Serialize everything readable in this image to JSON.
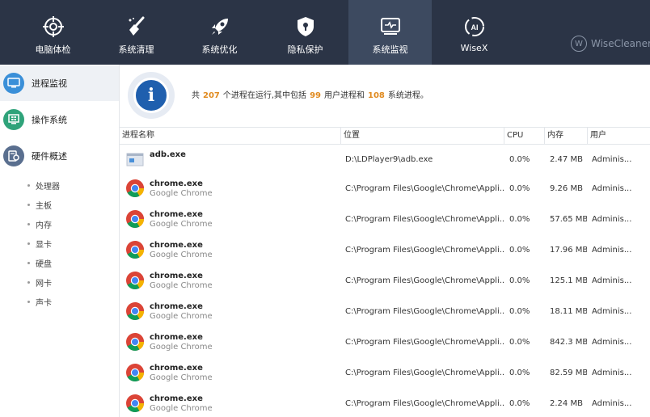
{
  "nav": [
    {
      "label": "电脑体检",
      "icon": "crosshair-icon"
    },
    {
      "label": "系统清理",
      "icon": "broom-icon"
    },
    {
      "label": "系统优化",
      "icon": "rocket-icon"
    },
    {
      "label": "隐私保护",
      "icon": "shield-lock-icon"
    },
    {
      "label": "系统监视",
      "icon": "monitor-pulse-icon"
    },
    {
      "label": "WiseX",
      "icon": "wisex-logo-icon"
    }
  ],
  "brand": {
    "name": "WiseCleaner"
  },
  "sidebar": {
    "items": [
      {
        "label": "进程监视",
        "icon": "monitor-icon",
        "color": "#3a8fd8"
      },
      {
        "label": "操作系统",
        "icon": "windows-icon",
        "color": "#2fa37a"
      },
      {
        "label": "硬件概述",
        "icon": "hardware-icon",
        "color": "#5a6f8f"
      }
    ],
    "subitems": [
      "处理器",
      "主板",
      "内存",
      "显卡",
      "硬盘",
      "网卡",
      "声卡"
    ]
  },
  "summary": {
    "prefix": "共",
    "total": "207",
    "mid1": "个进程在运行,其中包括",
    "user": "99",
    "mid2": "用户进程和",
    "system": "108",
    "suffix": "系统进程。"
  },
  "table": {
    "columns": [
      "进程名称",
      "位置",
      "CPU",
      "内存",
      "用户"
    ],
    "rows": [
      {
        "name": "adb.exe",
        "desc": "",
        "path": "D:\\LDPlayer9\\adb.exe",
        "cpu": "0.0%",
        "mem": "2.47 MB",
        "user": "Adminis...",
        "icon": "exe-icon"
      },
      {
        "name": "chrome.exe",
        "desc": "Google Chrome",
        "path": "C:\\Program Files\\Google\\Chrome\\Appli...",
        "cpu": "0.0%",
        "mem": "9.26 MB",
        "user": "Adminis...",
        "icon": "chrome-icon"
      },
      {
        "name": "chrome.exe",
        "desc": "Google Chrome",
        "path": "C:\\Program Files\\Google\\Chrome\\Appli...",
        "cpu": "0.0%",
        "mem": "57.65 MB",
        "user": "Adminis...",
        "icon": "chrome-icon"
      },
      {
        "name": "chrome.exe",
        "desc": "Google Chrome",
        "path": "C:\\Program Files\\Google\\Chrome\\Appli...",
        "cpu": "0.0%",
        "mem": "17.96 MB",
        "user": "Adminis...",
        "icon": "chrome-icon"
      },
      {
        "name": "chrome.exe",
        "desc": "Google Chrome",
        "path": "C:\\Program Files\\Google\\Chrome\\Appli...",
        "cpu": "0.0%",
        "mem": "125.1 MB",
        "user": "Adminis...",
        "icon": "chrome-icon"
      },
      {
        "name": "chrome.exe",
        "desc": "Google Chrome",
        "path": "C:\\Program Files\\Google\\Chrome\\Appli...",
        "cpu": "0.0%",
        "mem": "18.11 MB",
        "user": "Adminis...",
        "icon": "chrome-icon"
      },
      {
        "name": "chrome.exe",
        "desc": "Google Chrome",
        "path": "C:\\Program Files\\Google\\Chrome\\Appli...",
        "cpu": "0.0%",
        "mem": "842.3 MB",
        "user": "Adminis...",
        "icon": "chrome-icon"
      },
      {
        "name": "chrome.exe",
        "desc": "Google Chrome",
        "path": "C:\\Program Files\\Google\\Chrome\\Appli...",
        "cpu": "0.0%",
        "mem": "82.59 MB",
        "user": "Adminis...",
        "icon": "chrome-icon"
      },
      {
        "name": "chrome.exe",
        "desc": "Google Chrome",
        "path": "C:\\Program Files\\Google\\Chrome\\Appli...",
        "cpu": "0.0%",
        "mem": "2.24 MB",
        "user": "Adminis...",
        "icon": "chrome-icon"
      }
    ]
  },
  "colors": {
    "topbar": "#2b3446",
    "accent": "#e08a1e",
    "info": "#1f5fae"
  }
}
